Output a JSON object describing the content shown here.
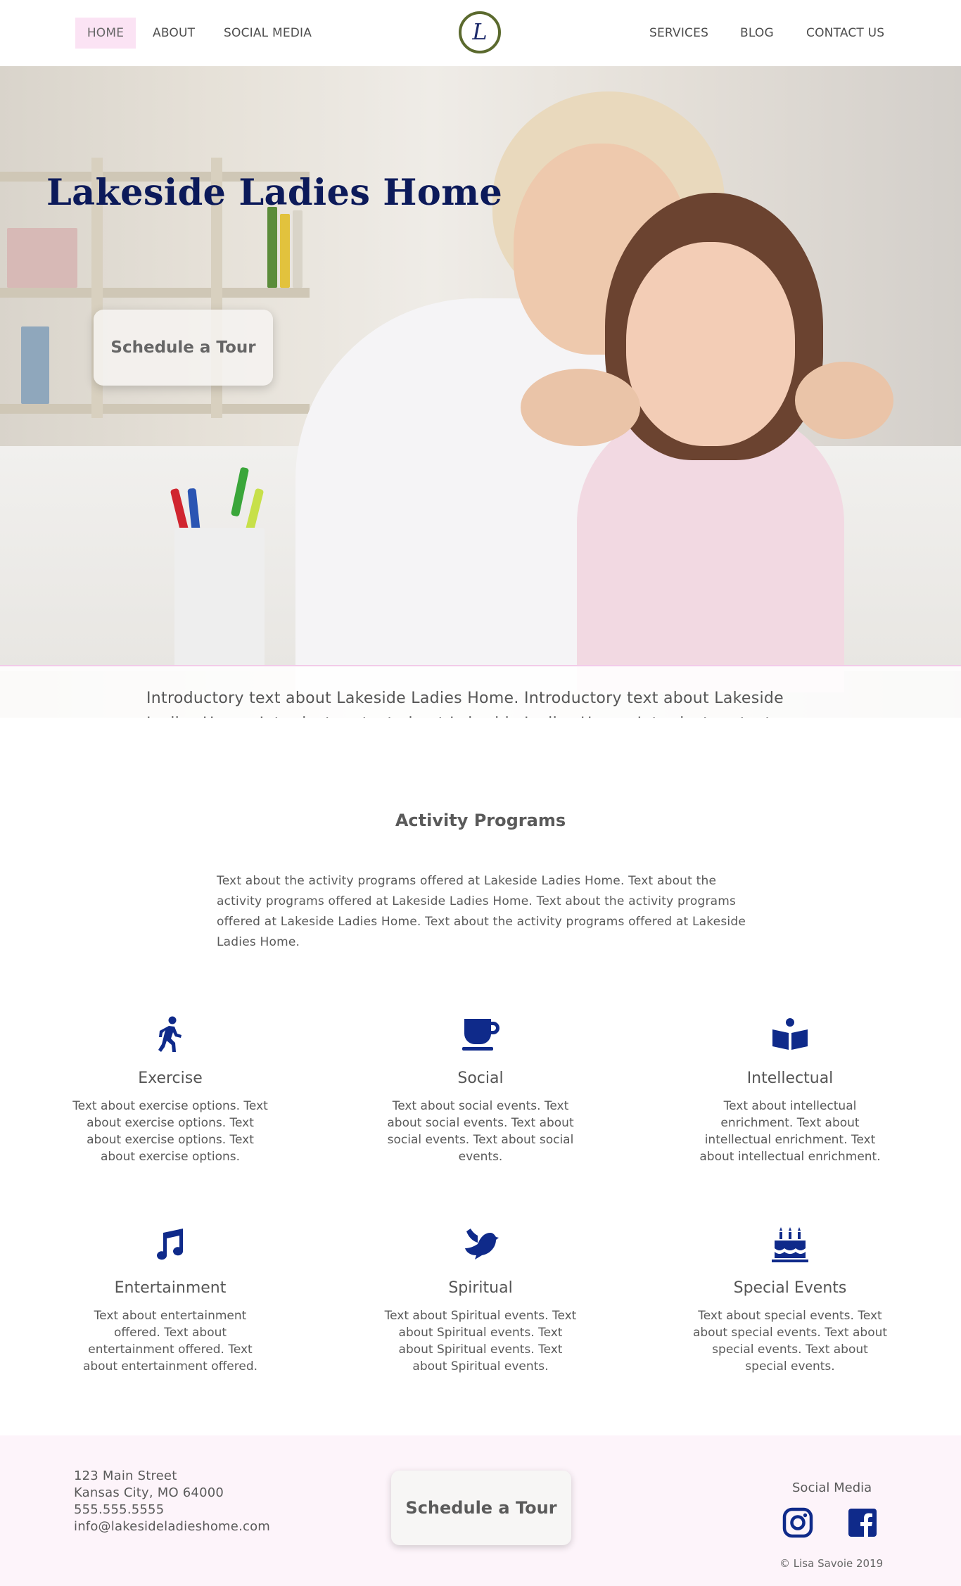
{
  "nav": {
    "left_items": [
      "HOME",
      "ABOUT",
      "SOCIAL MEDIA"
    ],
    "right_items": [
      "SERVICES",
      "BLOG",
      "CONTACT US"
    ],
    "logo_letter": "L",
    "active_color": "#fbe3f4"
  },
  "hero": {
    "title": "Lakeside Ladies Home",
    "tour_button": "Schedule a Tour",
    "intro": "Introductory text about Lakeside Ladies Home. Introductory text about Lakeside Ladies Home. Introductory text about Lakeside Ladies Home. Introductory text about Lakeside Ladies Home."
  },
  "activities": {
    "title": "Activity Programs",
    "text": "Text about the activity programs offered at Lakeside Ladies Home. Text about the activity programs offered at Lakeside Ladies Home. Text about the activity programs offered at Lakeside Ladies Home. Text about the activity programs offered at Lakeside Ladies Home.",
    "icon_color": "#0f2a8a",
    "cards": [
      {
        "icon": "walking-icon",
        "title": "Exercise",
        "text": "Text about exercise options. Text about exercise options. Text about exercise options. Text about exercise options."
      },
      {
        "icon": "mug-icon",
        "title": "Social",
        "text": "Text about social events. Text about social events. Text about social events. Text about social events."
      },
      {
        "icon": "book-reader-icon",
        "title": "Intellectual",
        "text": "Text about intellectual enrichment. Text about intellectual enrichment. Text about intellectual enrichment."
      },
      {
        "icon": "music-icon",
        "title": "Entertainment",
        "text": "Text about entertainment offered. Text about entertainment offered. Text about entertainment offered."
      },
      {
        "icon": "dove-icon",
        "title": "Spiritual",
        "text": "Text about Spiritual events. Text about Spiritual events. Text about Spiritual events. Text about Spiritual events."
      },
      {
        "icon": "birthday-cake-icon",
        "title": "Special Events",
        "text": "Text about special events. Text about special events. Text about special events. Text about special events."
      }
    ]
  },
  "footer": {
    "address": [
      "123 Main Street",
      "Kansas City, MO 64000",
      "555.555.5555",
      "info@lakesideladieshome.com"
    ],
    "tour_button": "Schedule a Tour",
    "social_label": "Social Media",
    "social_icons": [
      "instagram-icon",
      "facebook-icon"
    ],
    "copyright": "© Lisa Savoie 2019",
    "background": "#fdf4fa"
  }
}
